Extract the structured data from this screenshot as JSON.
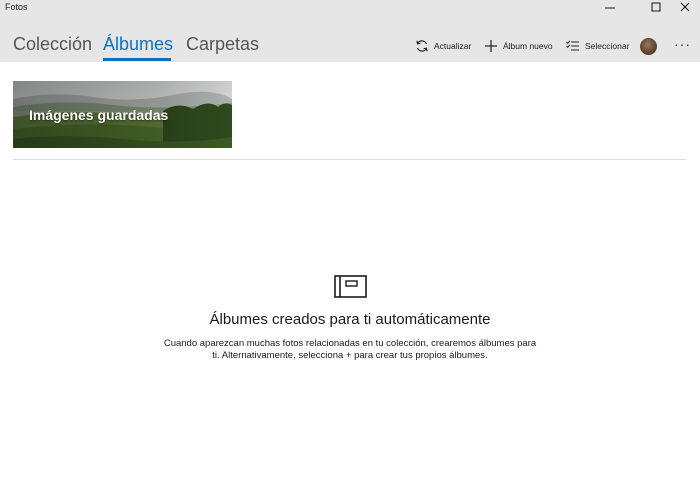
{
  "window": {
    "title": "Fotos"
  },
  "tabs": [
    {
      "label": "Colección",
      "active": false
    },
    {
      "label": "Álbumes",
      "active": true
    },
    {
      "label": "Carpetas",
      "active": false
    }
  ],
  "toolbar": {
    "refresh_label": "Actualizar",
    "new_album_label": "Álbum nuevo",
    "select_label": "Seleccionar",
    "more_label": "···"
  },
  "albums": [
    {
      "title": "Imágenes guardadas"
    }
  ],
  "empty_state": {
    "icon": "album-icon",
    "heading": "Álbumes creados para ti automáticamente",
    "description": "Cuando aparezcan muchas fotos relacionadas en tu colección, crearemos álbumes para ti. Alternativamente, selecciona + para crear tus propios álbumes."
  },
  "colors": {
    "accent": "#0b73c5",
    "titlebar_bg": "#e6e6e6"
  }
}
